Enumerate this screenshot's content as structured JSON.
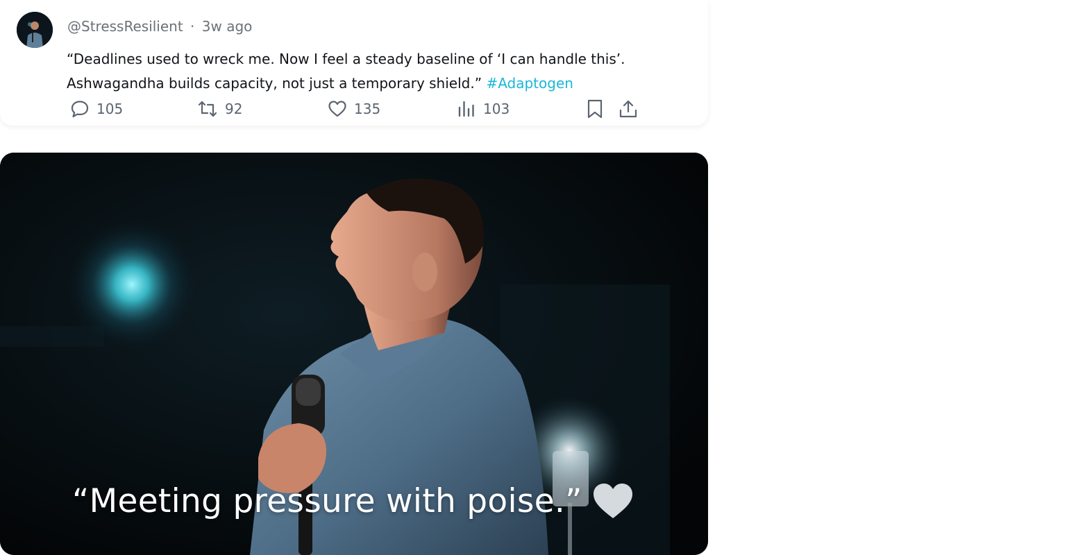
{
  "post": {
    "handle": "@StressResilient",
    "separator": "·",
    "time_ago": "3w ago",
    "text_line1": "“Deadlines used to wreck me. Now I feel a steady baseline of ‘I can handle this’.",
    "text_line2": "Ashwagandha builds capacity, not just a temporary shield.”",
    "hashtag": "#Adaptogen",
    "hashtag_color": "#19b7d8"
  },
  "actions": {
    "replies": "105",
    "reposts": "92",
    "likes": "135",
    "views": "103"
  },
  "icons": {
    "reply": "speech-bubble-icon",
    "repost": "repost-icon",
    "like": "heart-icon",
    "views": "bar-chart-icon",
    "bookmark": "bookmark-icon",
    "share": "share-upload-icon"
  },
  "media": {
    "caption": "“Meeting pressure with poise.”",
    "caption_icon": "white-heart-icon"
  }
}
